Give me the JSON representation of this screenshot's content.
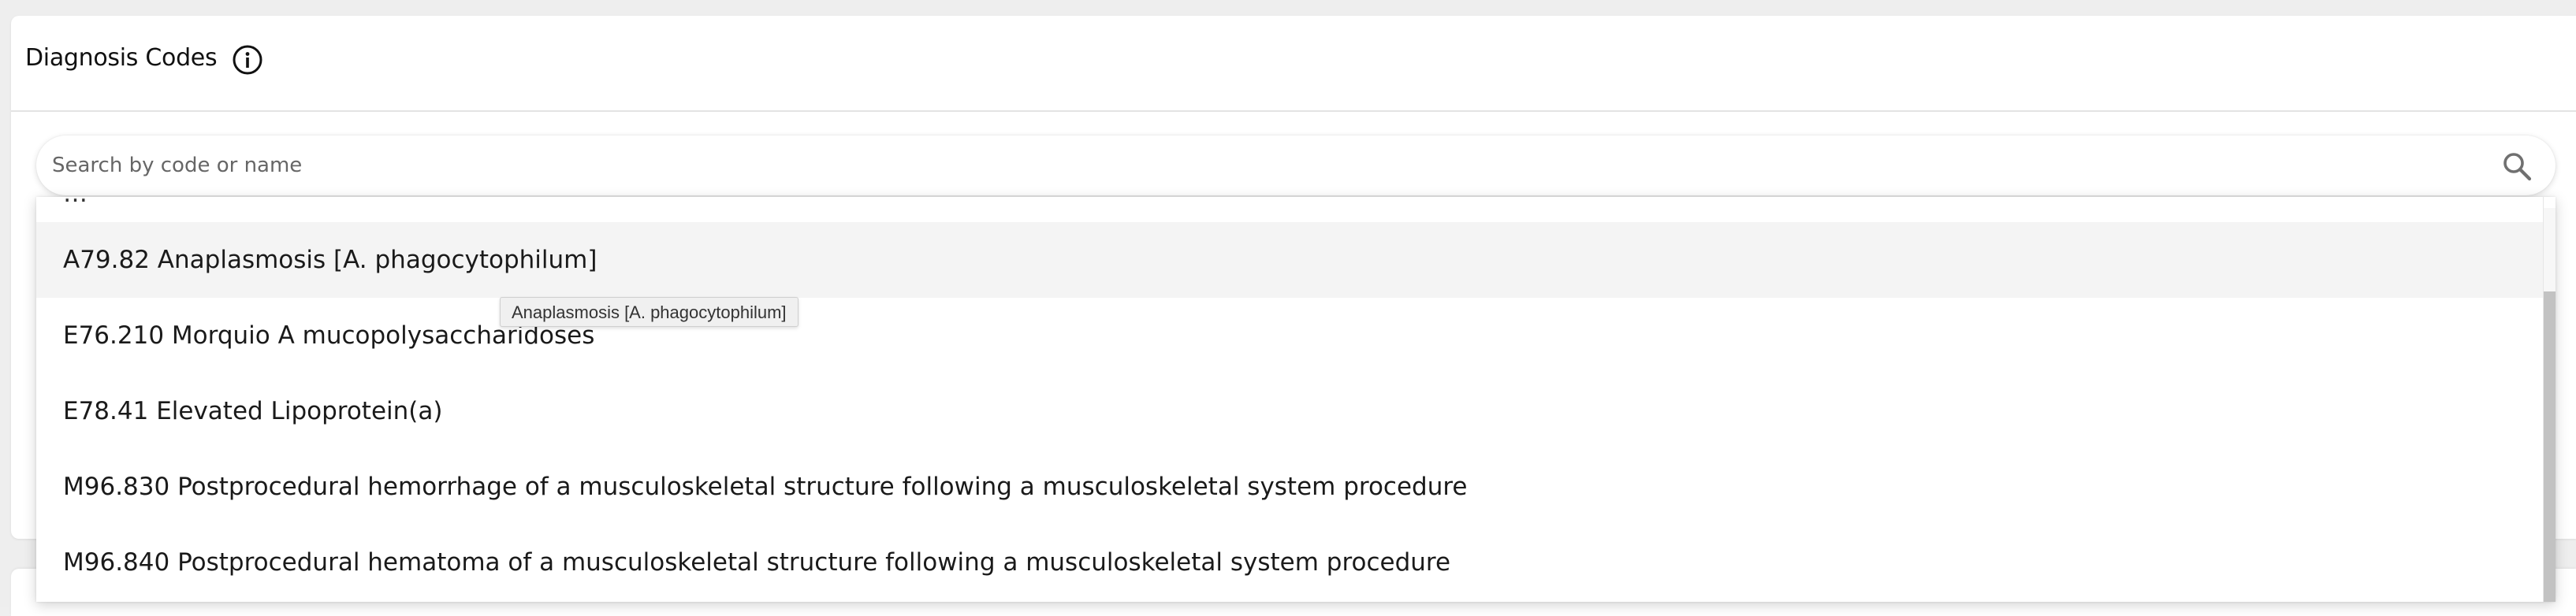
{
  "card": {
    "title": "Diagnosis Codes",
    "info_icon": "info-circle-icon"
  },
  "search": {
    "placeholder": "Search by code or name",
    "value": "",
    "icon": "magnifier-icon"
  },
  "dropdown": {
    "partial_item": "…",
    "options": [
      {
        "code": "A79.82",
        "name": "Anaplasmosis [A. phagocytophilum]",
        "label": "A79.82 Anaplasmosis [A. phagocytophilum]",
        "hovered": true
      },
      {
        "code": "E76.210",
        "name": "Morquio A mucopolysaccharidoses",
        "label": "E76.210 Morquio A mucopolysaccharidoses",
        "hovered": false
      },
      {
        "code": "E78.41",
        "name": "Elevated Lipoprotein(a)",
        "label": "E78.41 Elevated Lipoprotein(a)",
        "hovered": false
      },
      {
        "code": "M96.830",
        "name": "Postprocedural hemorrhage of a musculoskeletal structure following a musculoskeletal system procedure",
        "label": "M96.830 Postprocedural hemorrhage of a musculoskeletal structure following a musculoskeletal system procedure",
        "hovered": false
      },
      {
        "code": "M96.840",
        "name": "Postprocedural hematoma of a musculoskeletal structure following a musculoskeletal system procedure",
        "label": "M96.840 Postprocedural hematoma of a musculoskeletal structure following a musculoskeletal system procedure",
        "hovered": false
      }
    ]
  },
  "tooltip": {
    "text": "Anaplasmosis [A. phagocytophilum]"
  },
  "colors": {
    "hover_row": "#f4f4f4",
    "scrollbar_thumb": "#c2c2c2",
    "divider": "#e3e3e3"
  }
}
